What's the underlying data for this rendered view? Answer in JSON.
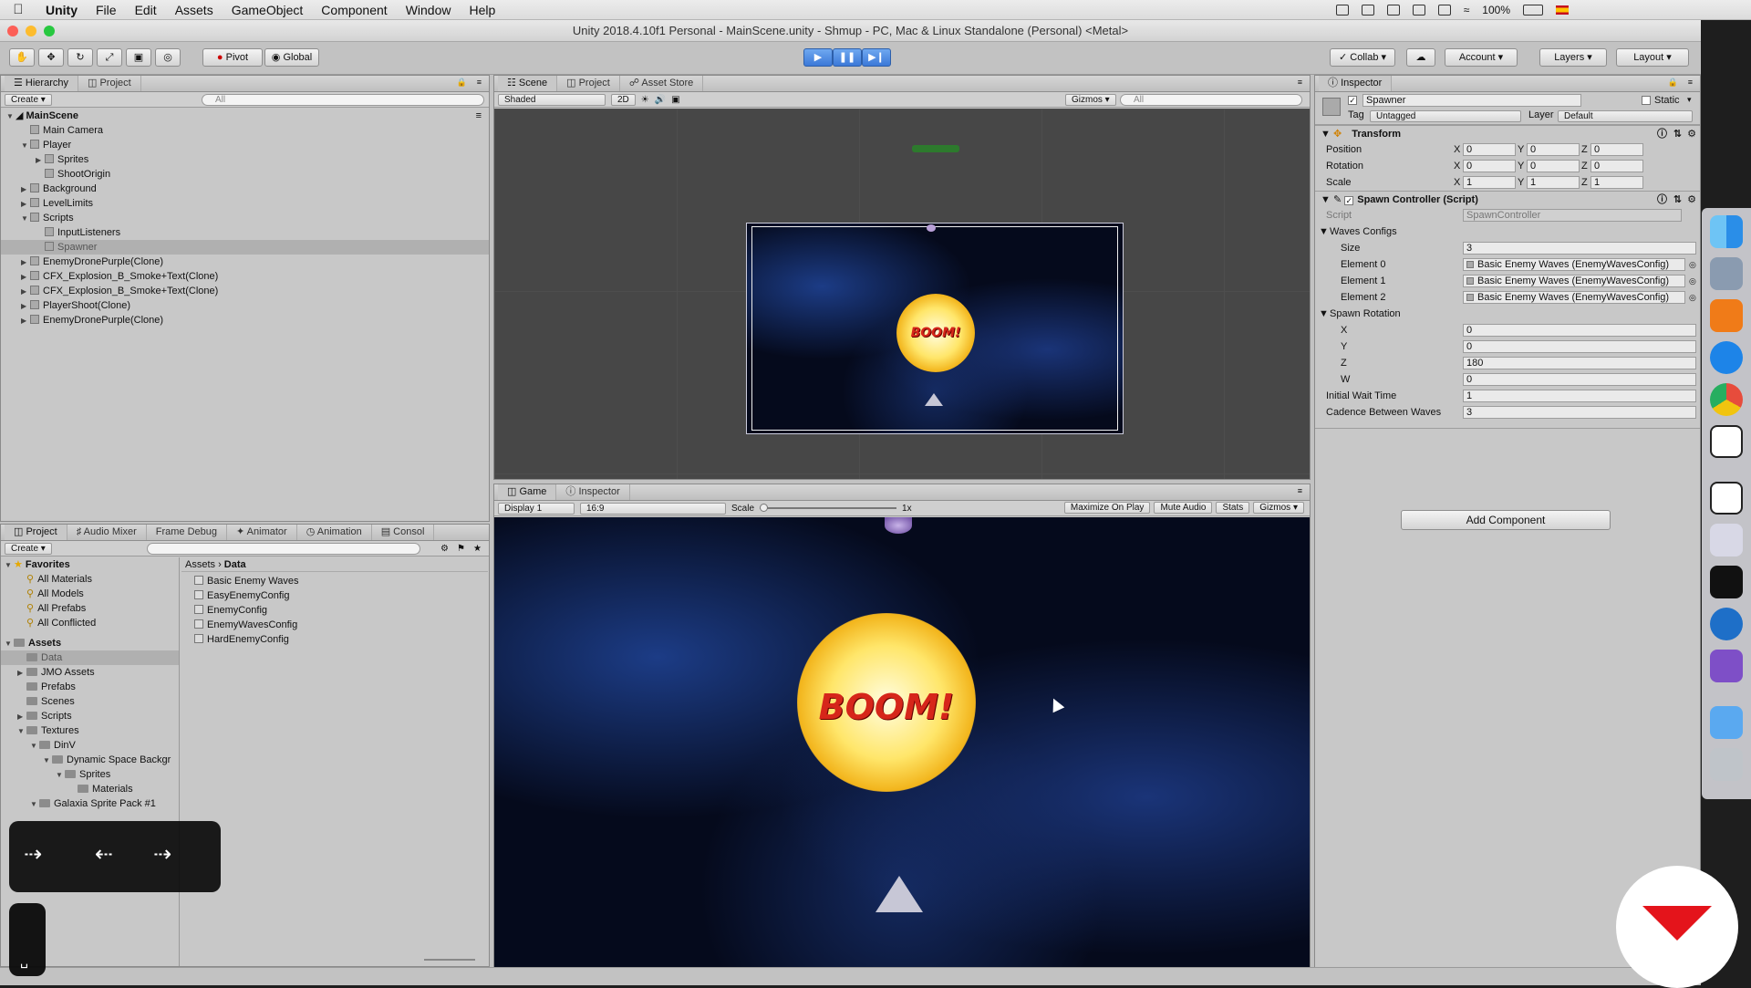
{
  "menubar": {
    "app": "Unity",
    "items": [
      "File",
      "Edit",
      "Assets",
      "GameObject",
      "Component",
      "Window",
      "Help"
    ],
    "battery": "100%"
  },
  "window": {
    "title": "Unity 2018.4.10f1 Personal - MainScene.unity - Shmup - PC, Mac & Linux Standalone (Personal) <Metal>"
  },
  "toolbar": {
    "pivot": "Pivot",
    "global": "Global",
    "collab": "Collab",
    "account": "Account",
    "layers": "Layers",
    "layout": "Layout"
  },
  "hierarchy": {
    "tabs": [
      "Hierarchy",
      "Project"
    ],
    "create": "Create",
    "search_placeholder": "All",
    "scene": "MainScene",
    "items": [
      {
        "label": "Main Camera",
        "indent": 1,
        "arrow": ""
      },
      {
        "label": "Player",
        "indent": 1,
        "arrow": "▼"
      },
      {
        "label": "Sprites",
        "indent": 2,
        "arrow": "▶"
      },
      {
        "label": "ShootOrigin",
        "indent": 2,
        "arrow": ""
      },
      {
        "label": "Background",
        "indent": 1,
        "arrow": "▶"
      },
      {
        "label": "LevelLimits",
        "indent": 1,
        "arrow": "▶"
      },
      {
        "label": "Scripts",
        "indent": 1,
        "arrow": "▼"
      },
      {
        "label": "InputListeners",
        "indent": 2,
        "arrow": ""
      },
      {
        "label": "Spawner",
        "indent": 2,
        "arrow": "",
        "selected": true
      },
      {
        "label": "EnemyDronePurple(Clone)",
        "indent": 1,
        "arrow": "▶"
      },
      {
        "label": "CFX_Explosion_B_Smoke+Text(Clone)",
        "indent": 1,
        "arrow": "▶"
      },
      {
        "label": "CFX_Explosion_B_Smoke+Text(Clone)",
        "indent": 1,
        "arrow": "▶"
      },
      {
        "label": "PlayerShoot(Clone)",
        "indent": 1,
        "arrow": "▶"
      },
      {
        "label": "EnemyDronePurple(Clone)",
        "indent": 1,
        "arrow": "▶"
      }
    ]
  },
  "scene_panel": {
    "tabs": [
      "Scene",
      "Project",
      "Asset Store"
    ],
    "shading": "Shaded",
    "mode2d": "2D",
    "gizmos": "Gizmos",
    "search_placeholder": "All"
  },
  "game_panel": {
    "tabs": [
      "Game",
      "Inspector"
    ],
    "display": "Display 1",
    "aspect": "16:9",
    "scale_label": "Scale",
    "scale_value": "1x",
    "maximize": "Maximize On Play",
    "mute": "Mute Audio",
    "stats": "Stats",
    "gizmos": "Gizmos",
    "boom_text": "BOOM!"
  },
  "project": {
    "tabs": [
      "Project",
      "Audio Mixer",
      "Frame Debug",
      "Animator",
      "Animation",
      "Consol"
    ],
    "create": "Create",
    "favorites_label": "Favorites",
    "favorites": [
      "All Materials",
      "All Models",
      "All Prefabs",
      "All Conflicted"
    ],
    "assets_label": "Assets",
    "assets_tree": [
      {
        "label": "Data",
        "indent": 1,
        "arrow": "",
        "selected": true
      },
      {
        "label": "JMO Assets",
        "indent": 1,
        "arrow": "▶"
      },
      {
        "label": "Prefabs",
        "indent": 1,
        "arrow": ""
      },
      {
        "label": "Scenes",
        "indent": 1,
        "arrow": ""
      },
      {
        "label": "Scripts",
        "indent": 1,
        "arrow": "▶"
      },
      {
        "label": "Textures",
        "indent": 1,
        "arrow": "▼"
      },
      {
        "label": "DinV",
        "indent": 2,
        "arrow": "▼"
      },
      {
        "label": "Dynamic Space Backgr",
        "indent": 3,
        "arrow": "▼"
      },
      {
        "label": "Sprites",
        "indent": 4,
        "arrow": "▼"
      },
      {
        "label": "Materials",
        "indent": 5,
        "arrow": ""
      },
      {
        "label": "Galaxia Sprite Pack #1",
        "indent": 2,
        "arrow": "▼"
      }
    ],
    "breadcrumb": [
      "Assets",
      "Data"
    ],
    "files": [
      "Basic Enemy Waves",
      "EasyEnemyConfig",
      "EnemyConfig",
      "EnemyWavesConfig",
      "HardEnemyConfig"
    ]
  },
  "inspector": {
    "tab": "Inspector",
    "object_name": "Spawner",
    "static_label": "Static",
    "tag_label": "Tag",
    "tag_value": "Untagged",
    "layer_label": "Layer",
    "layer_value": "Default",
    "transform": {
      "title": "Transform",
      "rows": [
        {
          "label": "Position",
          "x": "0",
          "y": "0",
          "z": "0"
        },
        {
          "label": "Rotation",
          "x": "0",
          "y": "0",
          "z": "0"
        },
        {
          "label": "Scale",
          "x": "1",
          "y": "1",
          "z": "1"
        }
      ]
    },
    "spawn": {
      "title": "Spawn Controller (Script)",
      "script_label": "Script",
      "script_value": "SpawnController",
      "waves_label": "Waves Configs",
      "size_label": "Size",
      "size_value": "3",
      "elements": [
        {
          "label": "Element 0",
          "value": "Basic Enemy Waves (EnemyWavesConfig)"
        },
        {
          "label": "Element 1",
          "value": "Basic Enemy Waves (EnemyWavesConfig)"
        },
        {
          "label": "Element 2",
          "value": "Basic Enemy Waves (EnemyWavesConfig)"
        }
      ],
      "rotation_label": "Spawn Rotation",
      "rotation": [
        {
          "label": "X",
          "value": "0"
        },
        {
          "label": "Y",
          "value": "0"
        },
        {
          "label": "Z",
          "value": "180"
        },
        {
          "label": "W",
          "value": "0"
        }
      ],
      "wait_label": "Initial Wait Time",
      "wait_value": "1",
      "cadence_label": "Cadence Between Waves",
      "cadence_value": "3"
    },
    "add_component": "Add Component"
  },
  "colors": {
    "play_accent": "#3b78d8",
    "selection": "#b0b0b0",
    "boom_red": "#d6261a"
  }
}
